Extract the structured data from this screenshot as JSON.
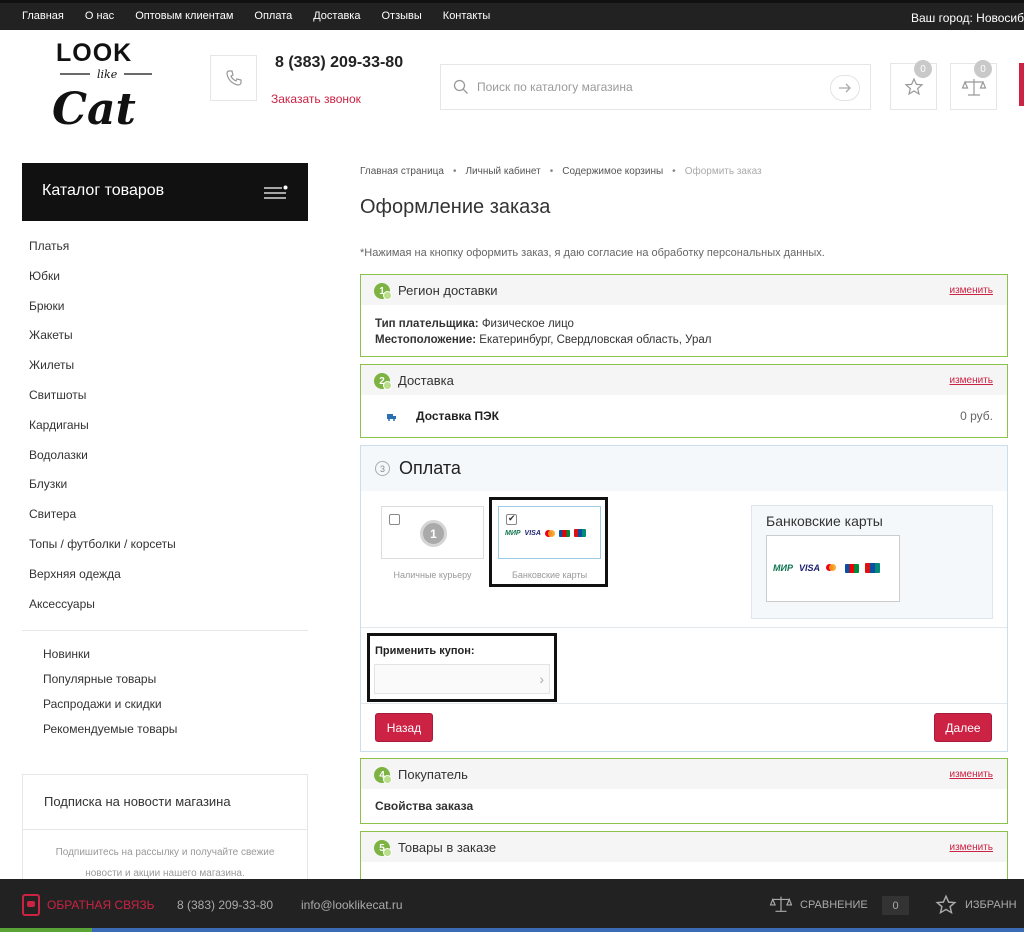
{
  "topbar": {
    "nav": [
      "Главная",
      "О нас",
      "Оптовым клиентам",
      "Оплата",
      "Доставка",
      "Отзывы",
      "Контакты"
    ],
    "city": "Ваш город: Новосиб"
  },
  "header": {
    "logo_text": [
      "LOOK",
      "like",
      "Cat"
    ],
    "phone": "8 (383) 209-33-80",
    "callback": "Заказать звонок",
    "search_placeholder": "Поиск по каталогу магазина",
    "favorites_count": "0",
    "compare_count": "0"
  },
  "sidebar": {
    "catalog_title": "Каталог товаров",
    "categories": [
      "Платья",
      "Юбки",
      "Брюки",
      "Жакеты",
      "Жилеты",
      "Свитшоты",
      "Кардиганы",
      "Водолазки",
      "Блузки",
      "Свитера",
      "Топы / футболки / корсеты",
      "Верхняя одежда",
      "Аксессуары"
    ],
    "extra": [
      "Новинки",
      "Популярные товары",
      "Распродажи и скидки",
      "Рекомендуемые товары"
    ],
    "subscribe_title": "Подписка на новости магазина",
    "subscribe_text": "Подпишитесь на рассылку и получайте свежие новости и акции нашего магазина."
  },
  "main": {
    "breadcrumbs": [
      "Главная страница",
      "Личный кабинет",
      "Содержимое корзины",
      "Оформить заказ"
    ],
    "title": "Оформление заказа",
    "consent": "*Нажимая на кнопку оформить заказ, я даю согласие на обработку персональных данных.",
    "edit_label": "изменить",
    "region": {
      "num": "1",
      "title": "Регион доставки",
      "payer_label": "Тип плательщика:",
      "payer_value": "Физическое лицо",
      "location_label": "Местоположение:",
      "location_value": "Екатеринбург, Свердловская область, Урал"
    },
    "delivery": {
      "num": "2",
      "title": "Доставка",
      "method": "Доставка ПЭК",
      "price": "0 руб."
    },
    "payment": {
      "num": "3",
      "title": "Оплата",
      "options": [
        {
          "label": "Наличные курьеру",
          "checked": false,
          "coin": "1"
        },
        {
          "label": "Банковские карты",
          "checked": true
        }
      ],
      "card_logos": [
        "МИР",
        "VISA"
      ],
      "selected_title": "Банковские карты",
      "coupon_label": "Применить купон:",
      "back": "Назад",
      "next": "Далее"
    },
    "buyer": {
      "num": "4",
      "title": "Покупатель",
      "props": "Свойства заказа"
    },
    "items": {
      "num": "5",
      "title": "Товары в заказе"
    }
  },
  "footer": {
    "feedback": "ОБРАТНАЯ СВЯЗЬ",
    "phone": "8 (383) 209-33-80",
    "email": "info@looklikecat.ru",
    "compare": "СРАВНЕНИЕ",
    "compare_count": "0",
    "favorites": "ИЗБРАНН"
  },
  "colors": {
    "accent": "#cc2244",
    "step_border": "#8cc14c",
    "dark": "#222222"
  }
}
